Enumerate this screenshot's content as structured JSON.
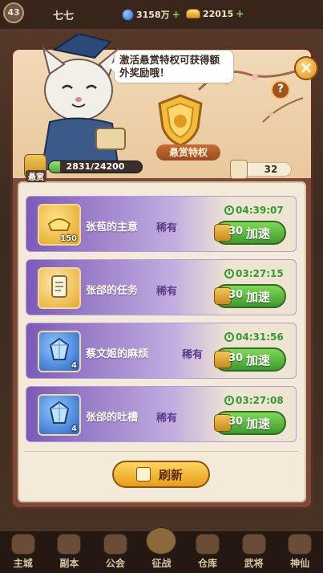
{
  "topbar": {
    "level": "43",
    "player_name": "七七",
    "gems": "3158万",
    "ingots": "22015",
    "plus": "+"
  },
  "dialog": {
    "bubble_text": "激活悬赏特权可获得额外奖励哦！",
    "close_label": "×",
    "help_label": "?",
    "privilege_label": "悬赏特权",
    "bounty_tag": "悬赏",
    "bounty_progress": "2831/24200",
    "bounty_fraction": 0.117,
    "token_count": "32",
    "refresh_label": "刷新"
  },
  "tasks": [
    {
      "name": "张苞的主意",
      "rarity": "稀有",
      "timer": "04:39:07",
      "cost": "30",
      "action": "加速",
      "icon": "gold-ingot-icon",
      "qty": "150"
    },
    {
      "name": "张郃的任务",
      "rarity": "稀有",
      "timer": "03:27:15",
      "cost": "30",
      "action": "加速",
      "icon": "scroll-icon",
      "qty": ""
    },
    {
      "name": "蔡文姬的麻烦",
      "rarity": "稀有",
      "timer": "04:31:56",
      "cost": "30",
      "action": "加速",
      "icon": "blue-gem-icon",
      "qty": "4"
    },
    {
      "name": "张郃的吐槽",
      "rarity": "稀有",
      "timer": "03:27:08",
      "cost": "30",
      "action": "加速",
      "icon": "blue-gem-icon",
      "qty": "4"
    }
  ],
  "bottom_nav": [
    "主城",
    "副本",
    "公会",
    "征战",
    "仓库",
    "武将",
    "神仙"
  ],
  "colors": {
    "accent_green": "#3f9a2f",
    "rarity_purple": "#7b5ab8",
    "gold": "#e89c1a"
  }
}
